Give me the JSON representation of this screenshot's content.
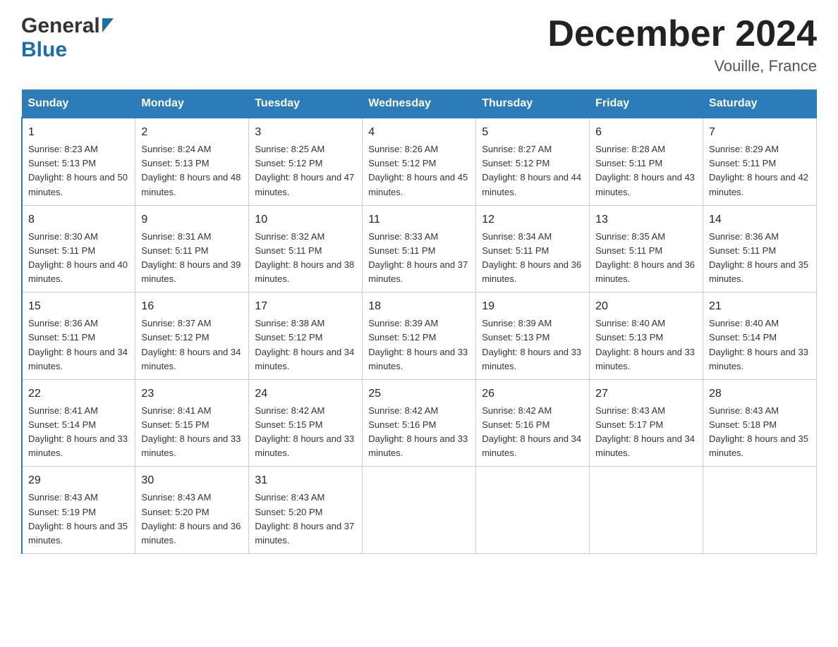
{
  "logo": {
    "general": "General",
    "blue": "Blue"
  },
  "title": "December 2024",
  "location": "Vouille, France",
  "days_header": [
    "Sunday",
    "Monday",
    "Tuesday",
    "Wednesday",
    "Thursday",
    "Friday",
    "Saturday"
  ],
  "weeks": [
    [
      {
        "day": "1",
        "sunrise": "8:23 AM",
        "sunset": "5:13 PM",
        "daylight": "8 hours and 50 minutes."
      },
      {
        "day": "2",
        "sunrise": "8:24 AM",
        "sunset": "5:13 PM",
        "daylight": "8 hours and 48 minutes."
      },
      {
        "day": "3",
        "sunrise": "8:25 AM",
        "sunset": "5:12 PM",
        "daylight": "8 hours and 47 minutes."
      },
      {
        "day": "4",
        "sunrise": "8:26 AM",
        "sunset": "5:12 PM",
        "daylight": "8 hours and 45 minutes."
      },
      {
        "day": "5",
        "sunrise": "8:27 AM",
        "sunset": "5:12 PM",
        "daylight": "8 hours and 44 minutes."
      },
      {
        "day": "6",
        "sunrise": "8:28 AM",
        "sunset": "5:11 PM",
        "daylight": "8 hours and 43 minutes."
      },
      {
        "day": "7",
        "sunrise": "8:29 AM",
        "sunset": "5:11 PM",
        "daylight": "8 hours and 42 minutes."
      }
    ],
    [
      {
        "day": "8",
        "sunrise": "8:30 AM",
        "sunset": "5:11 PM",
        "daylight": "8 hours and 40 minutes."
      },
      {
        "day": "9",
        "sunrise": "8:31 AM",
        "sunset": "5:11 PM",
        "daylight": "8 hours and 39 minutes."
      },
      {
        "day": "10",
        "sunrise": "8:32 AM",
        "sunset": "5:11 PM",
        "daylight": "8 hours and 38 minutes."
      },
      {
        "day": "11",
        "sunrise": "8:33 AM",
        "sunset": "5:11 PM",
        "daylight": "8 hours and 37 minutes."
      },
      {
        "day": "12",
        "sunrise": "8:34 AM",
        "sunset": "5:11 PM",
        "daylight": "8 hours and 36 minutes."
      },
      {
        "day": "13",
        "sunrise": "8:35 AM",
        "sunset": "5:11 PM",
        "daylight": "8 hours and 36 minutes."
      },
      {
        "day": "14",
        "sunrise": "8:36 AM",
        "sunset": "5:11 PM",
        "daylight": "8 hours and 35 minutes."
      }
    ],
    [
      {
        "day": "15",
        "sunrise": "8:36 AM",
        "sunset": "5:11 PM",
        "daylight": "8 hours and 34 minutes."
      },
      {
        "day": "16",
        "sunrise": "8:37 AM",
        "sunset": "5:12 PM",
        "daylight": "8 hours and 34 minutes."
      },
      {
        "day": "17",
        "sunrise": "8:38 AM",
        "sunset": "5:12 PM",
        "daylight": "8 hours and 34 minutes."
      },
      {
        "day": "18",
        "sunrise": "8:39 AM",
        "sunset": "5:12 PM",
        "daylight": "8 hours and 33 minutes."
      },
      {
        "day": "19",
        "sunrise": "8:39 AM",
        "sunset": "5:13 PM",
        "daylight": "8 hours and 33 minutes."
      },
      {
        "day": "20",
        "sunrise": "8:40 AM",
        "sunset": "5:13 PM",
        "daylight": "8 hours and 33 minutes."
      },
      {
        "day": "21",
        "sunrise": "8:40 AM",
        "sunset": "5:14 PM",
        "daylight": "8 hours and 33 minutes."
      }
    ],
    [
      {
        "day": "22",
        "sunrise": "8:41 AM",
        "sunset": "5:14 PM",
        "daylight": "8 hours and 33 minutes."
      },
      {
        "day": "23",
        "sunrise": "8:41 AM",
        "sunset": "5:15 PM",
        "daylight": "8 hours and 33 minutes."
      },
      {
        "day": "24",
        "sunrise": "8:42 AM",
        "sunset": "5:15 PM",
        "daylight": "8 hours and 33 minutes."
      },
      {
        "day": "25",
        "sunrise": "8:42 AM",
        "sunset": "5:16 PM",
        "daylight": "8 hours and 33 minutes."
      },
      {
        "day": "26",
        "sunrise": "8:42 AM",
        "sunset": "5:16 PM",
        "daylight": "8 hours and 34 minutes."
      },
      {
        "day": "27",
        "sunrise": "8:43 AM",
        "sunset": "5:17 PM",
        "daylight": "8 hours and 34 minutes."
      },
      {
        "day": "28",
        "sunrise": "8:43 AM",
        "sunset": "5:18 PM",
        "daylight": "8 hours and 35 minutes."
      }
    ],
    [
      {
        "day": "29",
        "sunrise": "8:43 AM",
        "sunset": "5:19 PM",
        "daylight": "8 hours and 35 minutes."
      },
      {
        "day": "30",
        "sunrise": "8:43 AM",
        "sunset": "5:20 PM",
        "daylight": "8 hours and 36 minutes."
      },
      {
        "day": "31",
        "sunrise": "8:43 AM",
        "sunset": "5:20 PM",
        "daylight": "8 hours and 37 minutes."
      },
      {
        "day": "",
        "sunrise": "",
        "sunset": "",
        "daylight": ""
      },
      {
        "day": "",
        "sunrise": "",
        "sunset": "",
        "daylight": ""
      },
      {
        "day": "",
        "sunrise": "",
        "sunset": "",
        "daylight": ""
      },
      {
        "day": "",
        "sunrise": "",
        "sunset": "",
        "daylight": ""
      }
    ]
  ],
  "labels": {
    "sunrise_prefix": "Sunrise: ",
    "sunset_prefix": "Sunset: ",
    "daylight_prefix": "Daylight: "
  }
}
